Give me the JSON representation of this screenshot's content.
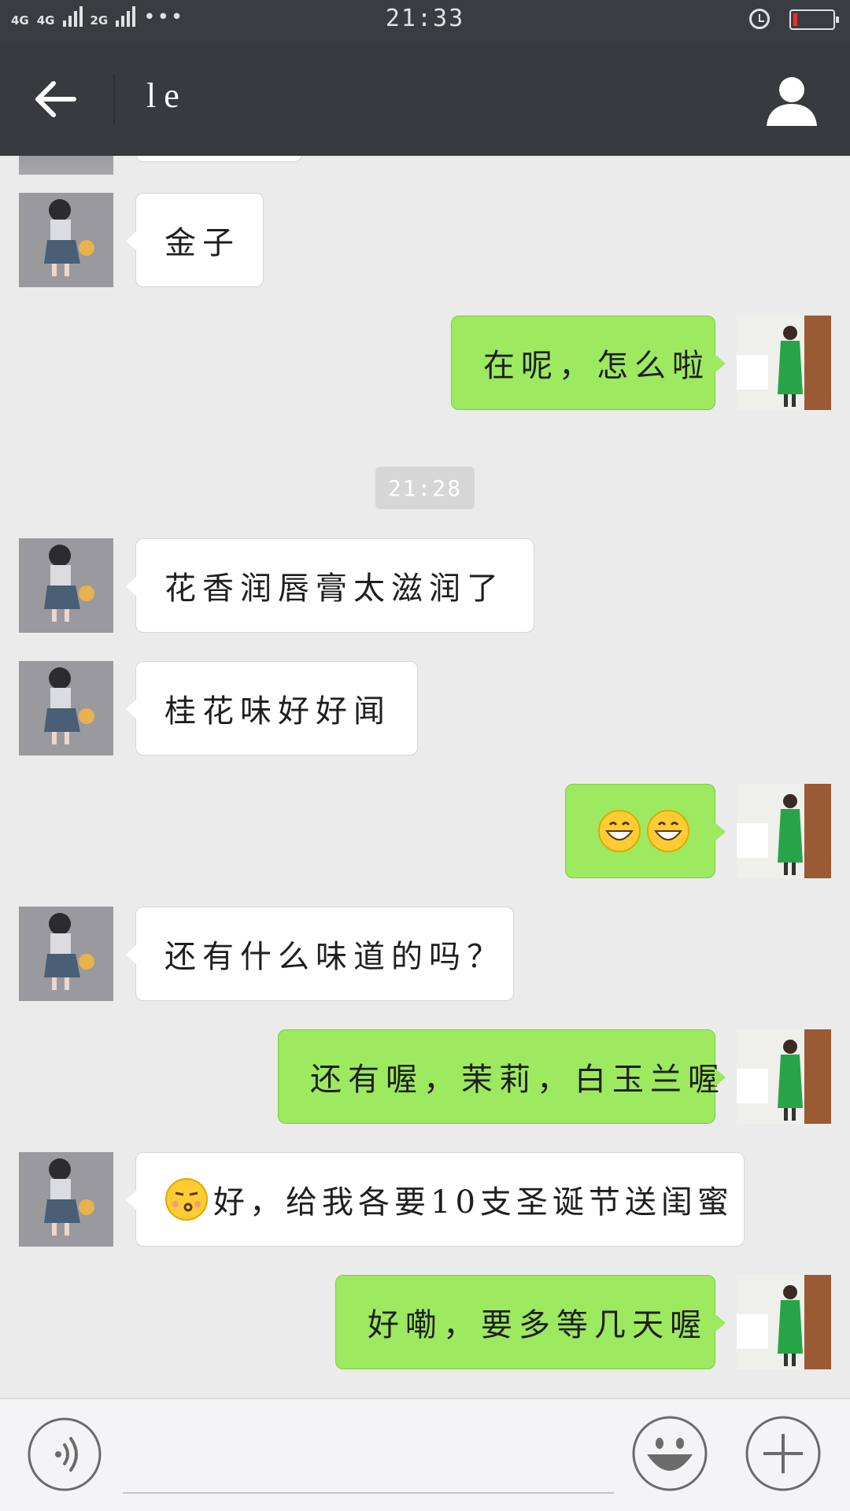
{
  "status_bar": {
    "network_1": "4G",
    "network_2": "4G",
    "network_3": "2G",
    "more": "•••",
    "time": "21:33",
    "battery_level": 0.1
  },
  "header": {
    "title": "le"
  },
  "messages": [
    {
      "direction": "in",
      "text": "金子"
    },
    {
      "direction": "out",
      "text": "在呢，怎么啦"
    },
    {
      "direction": "in",
      "text": "花香润唇膏太滋润了"
    },
    {
      "direction": "in",
      "text": "桂花味好好闻"
    },
    {
      "direction": "out",
      "text": "",
      "emoji": [
        "grinning-face",
        "grinning-face"
      ]
    },
    {
      "direction": "in",
      "text": "还有什么味道的吗？"
    },
    {
      "direction": "out",
      "text": "还有喔，茉莉，白玉兰喔"
    },
    {
      "direction": "in",
      "text": "好，给我各要10支圣诞节送闺蜜",
      "emoji": [
        "kissing-face"
      ]
    },
    {
      "direction": "out",
      "text": "好嘞，要多等几天喔"
    }
  ],
  "timestamp_divider": "21:28",
  "colors": {
    "header_bg": "#393a3f",
    "chat_bg": "#ebebeb",
    "outgoing_bubble": "#9de95f",
    "incoming_bubble": "#ffffff"
  },
  "icons": {
    "back": "arrow-left-icon",
    "profile": "person-icon",
    "voice": "voice-icon",
    "emoji": "smiley-icon",
    "plus": "plus-icon"
  }
}
